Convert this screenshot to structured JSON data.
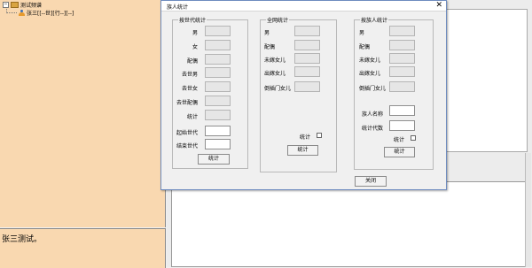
{
  "tree": {
    "root_label": "测试频谱",
    "expand_glyph": "−",
    "child_label": "张三[[--世][行--][--]"
  },
  "notes": {
    "text": "张三测试。"
  },
  "dialog": {
    "title": "族人统计",
    "close_glyph": "✕",
    "group_generation": {
      "title": "按世代统计",
      "male": "男",
      "female": "女",
      "spouse": "配偶",
      "deceased_male": "去世男",
      "deceased_female": "去世女",
      "deceased_spouse": "去世配偶",
      "total": "统计",
      "start_gen": "起始世代",
      "end_gen": "结束世代",
      "stat_button": "统计"
    },
    "group_all": {
      "title": "全网统计",
      "male": "男",
      "spouse": "配偶",
      "unmarried_daughter": "未嫁女儿",
      "married_daughter": "出嫁女儿",
      "adopted_daughter": "倒插门女儿",
      "stat_check_label": "统计",
      "stat_button": "统计"
    },
    "group_person": {
      "title": "按族人统计",
      "male": "男",
      "spouse": "配偶",
      "unmarried_daughter": "未嫁女儿",
      "married_daughter": "出嫁女儿",
      "adopted_daughter": "倒插门女儿",
      "person_name": "族人名称",
      "stat_generations": "统计代数",
      "stat_check_label": "统计",
      "stat_button": "统计"
    },
    "close_button": "关闭"
  }
}
